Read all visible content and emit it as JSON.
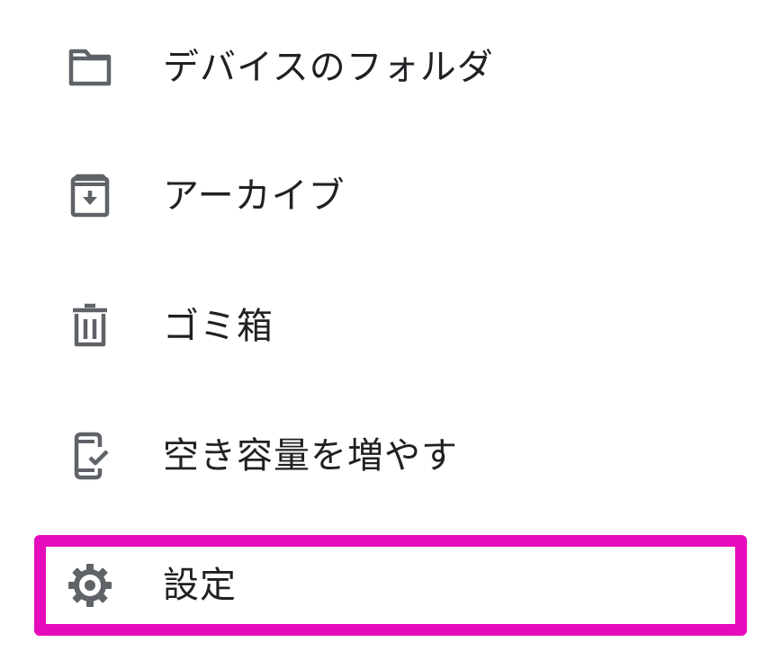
{
  "menu": {
    "items": [
      {
        "id": "device-folders",
        "label": "デバイスのフォルダ",
        "icon": "folder-icon"
      },
      {
        "id": "archive",
        "label": "アーカイブ",
        "icon": "archive-icon"
      },
      {
        "id": "trash",
        "label": "ゴミ箱",
        "icon": "trash-icon"
      },
      {
        "id": "free-up-space",
        "label": "空き容量を増やす",
        "icon": "phone-check-icon"
      },
      {
        "id": "settings",
        "label": "設定",
        "icon": "gear-icon"
      }
    ]
  },
  "colors": {
    "icon": "#5f6368",
    "text": "#202124",
    "highlight": "#e60bbd",
    "background": "#ffffff"
  }
}
